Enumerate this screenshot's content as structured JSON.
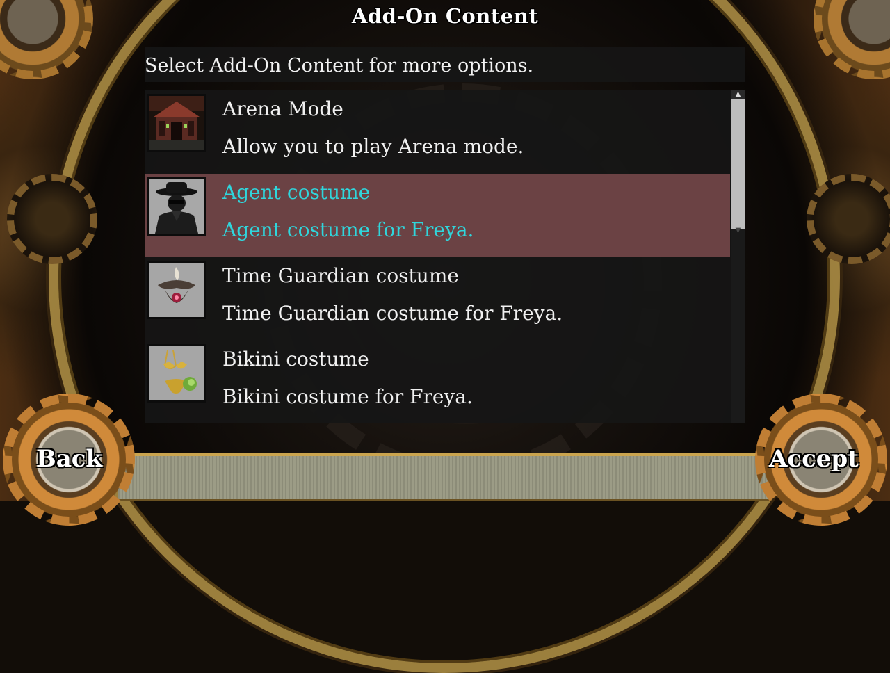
{
  "title": "Add-On Content",
  "instruction": "Select Add-On Content for more options.",
  "items": [
    {
      "title": "Arena Mode",
      "description": "Allow you to play Arena mode.",
      "icon": "arena-temple-icon",
      "selected": false
    },
    {
      "title": "Agent costume",
      "description": "Agent costume for Freya.",
      "icon": "agent-hat-icon",
      "selected": true
    },
    {
      "title": "Time Guardian costume",
      "description": "Time Guardian costume for Freya.",
      "icon": "time-guardian-helmet-icon",
      "selected": false
    },
    {
      "title": "Bikini costume",
      "description": "Bikini costume for Freya.",
      "icon": "bikini-icon",
      "selected": false
    }
  ],
  "buttons": {
    "back": "Back",
    "accept": "Accept"
  },
  "colors": {
    "selected_row": "#6b4244",
    "selected_text": "#2fd6dc",
    "panel": "#161616",
    "trim_gold": "#b39347"
  }
}
